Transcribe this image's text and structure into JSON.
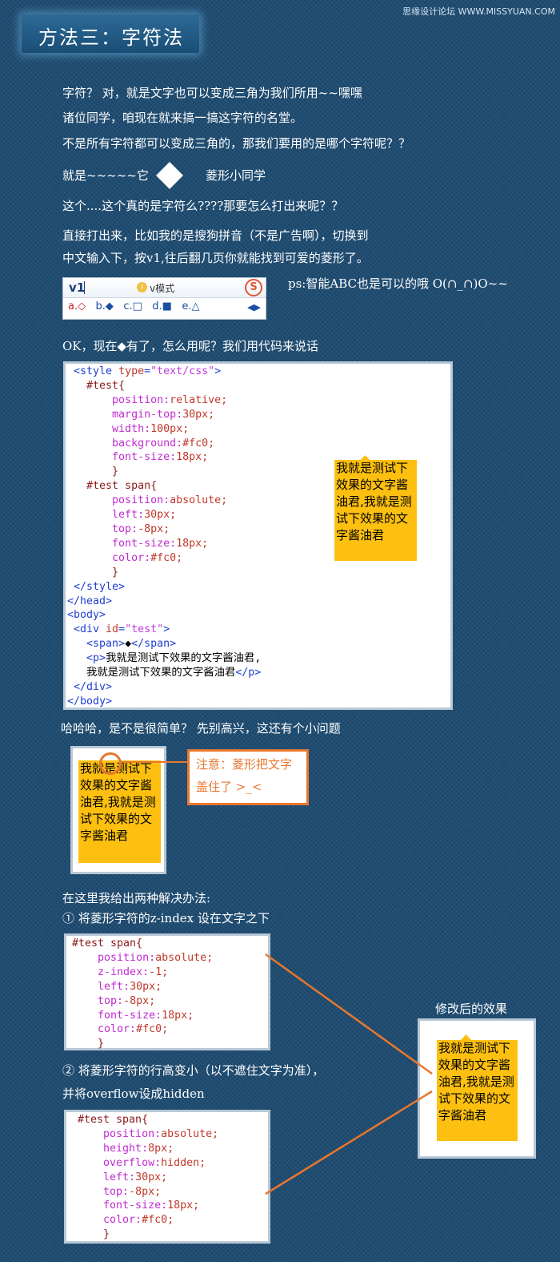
{
  "watermark": "思缘设计论坛 WWW.MISSYUAN.COM",
  "title": "方法三：字符法",
  "intro": {
    "line1": "字符？ 对，就是文字也可以变成三角为我们所用~~嘿嘿",
    "line2": "诸位同学，咱现在就来搞一搞这字符的名堂。",
    "line3": "不是所有字符都可以变成三角的，那我们要用的是哪个字符呢？？",
    "line4a": "就是~~~~~它",
    "line4b": "菱形小同学",
    "line5": "这个....这个真的是字符么????那要怎么打出来呢？？",
    "line6": "直接打出来，比如我的是搜狗拼音（不是广告啊），切换到",
    "line7": "中文输入下，按v1,往后翻几页你就能找到可爱的菱形了。"
  },
  "ime": {
    "input": "v1",
    "info_icon": "i",
    "mode": "v模式",
    "logo": "S",
    "candidates": [
      "a.◇",
      "b.◆",
      "c.□",
      "d.■",
      "e.△"
    ],
    "arrows": "◀▶"
  },
  "ps_note": "ps:智能ABC也是可以的哦 O(∩_∩)O~~",
  "ok_line": "OK，现在◆有了，怎么用呢？我们用代码来说话",
  "code1": {
    "l1_tag": "<style ",
    "l1_attr": "type",
    "l1_eq": "=",
    "l1_str": "\"text/css\"",
    "l1_end": ">",
    "l2": "#test{",
    "l3_p": "position:",
    "l3_v": "relative;",
    "l4_p": "margin-top:",
    "l4_v": "30px;",
    "l5_p": "width:",
    "l5_v": "100px;",
    "l6_p": "background:",
    "l6_v": "#fc0;",
    "l7_p": "font-size:",
    "l7_v": "18px;",
    "l8": "}",
    "l9": "#test span{",
    "l10_p": "position:",
    "l10_v": "absolute;",
    "l11_p": "left:",
    "l11_v": "30px;",
    "l12_p": "top:",
    "l12_v": "-8px;",
    "l13_p": "font-size:",
    "l13_v": "18px;",
    "l14_p": "color:",
    "l14_v": "#fc0;",
    "l15": "}",
    "l16": "</style>",
    "l17": "</head>",
    "l18": "<body>",
    "l19_tag": "<div ",
    "l19_attr": "id",
    "l19_eq": "=",
    "l19_str": "\"test\"",
    "l19_end": ">",
    "l20_tag1": "<span>",
    "l20_text": "◆",
    "l20_tag2": "</span>",
    "l21_tag": "<p>",
    "l21_text": "我就是测试下效果的文字酱油君,",
    "l22_text": "我就是测试下效果的文字酱油君",
    "l22_tag": "</p>",
    "l23": "</div>",
    "l24": "</body>"
  },
  "demo_text": "我就是测试下效果的文字酱油君,我就是测试下效果的文字酱油君",
  "haha_line": "哈哈哈，是不是很简单？  先别高兴，这还有个小问题",
  "note": {
    "line1": "注意：菱形把文字",
    "line2": "盖住了 >_<"
  },
  "solutions": {
    "heading": "在这里我给出两种解决办法:",
    "s1": "① 将菱形字符的z-index 设在文字之下",
    "s2a": "② 将菱形字符的行高变小（以不遮住文字为准），",
    "s2b": "并将overflow设成hidden",
    "result_label": "修改后的效果"
  },
  "code2": {
    "l1": "#test span{",
    "l2_p": "position:",
    "l2_v": "absolute;",
    "l3_p": "z-index:",
    "l3_v": "-1;",
    "l4_p": "left:",
    "l4_v": "30px;",
    "l5_p": "top:",
    "l5_v": "-8px;",
    "l6_p": "font-size:",
    "l6_v": "18px;",
    "l7_p": "color:",
    "l7_v": "#fc0;",
    "l8": "}"
  },
  "code3": {
    "l1": "#test span{",
    "l2_p": "position:",
    "l2_v": "absolute;",
    "l3_p": "height:",
    "l3_v": "8px;",
    "l4_p": "overflow:",
    "l4_v": "hidden;",
    "l5_p": "left:",
    "l5_v": "30px;",
    "l6_p": "top:",
    "l6_v": "-8px;",
    "l7_p": "font-size:",
    "l7_v": "18px;",
    "l8_p": "color:",
    "l8_v": "#fc0;",
    "l9": "}"
  }
}
